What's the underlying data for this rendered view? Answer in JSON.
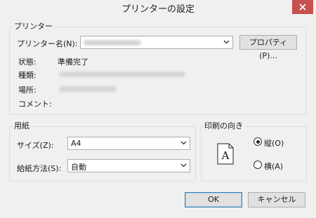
{
  "window": {
    "title": "プリンターの設定"
  },
  "printer_group": {
    "title": "プリンター",
    "name_label": "プリンター名(N):",
    "name_value": "",
    "properties_button": "プロパティ(P)...",
    "status_label": "状態:",
    "status_value": "準備完了",
    "type_label": "種類:",
    "location_label": "場所:",
    "comment_label": "コメント:"
  },
  "paper_group": {
    "title": "用紙",
    "size_label": "サイズ(Z):",
    "size_value": "A4",
    "source_label": "給紙方法(S):",
    "source_value": "自動"
  },
  "orientation_group": {
    "title": "印刷の向き",
    "portrait_label": "縦(O)",
    "landscape_label": "横(A)",
    "selected": "portrait",
    "preview_glyph": "A"
  },
  "buttons": {
    "ok": "OK",
    "cancel": "キャンセル"
  }
}
